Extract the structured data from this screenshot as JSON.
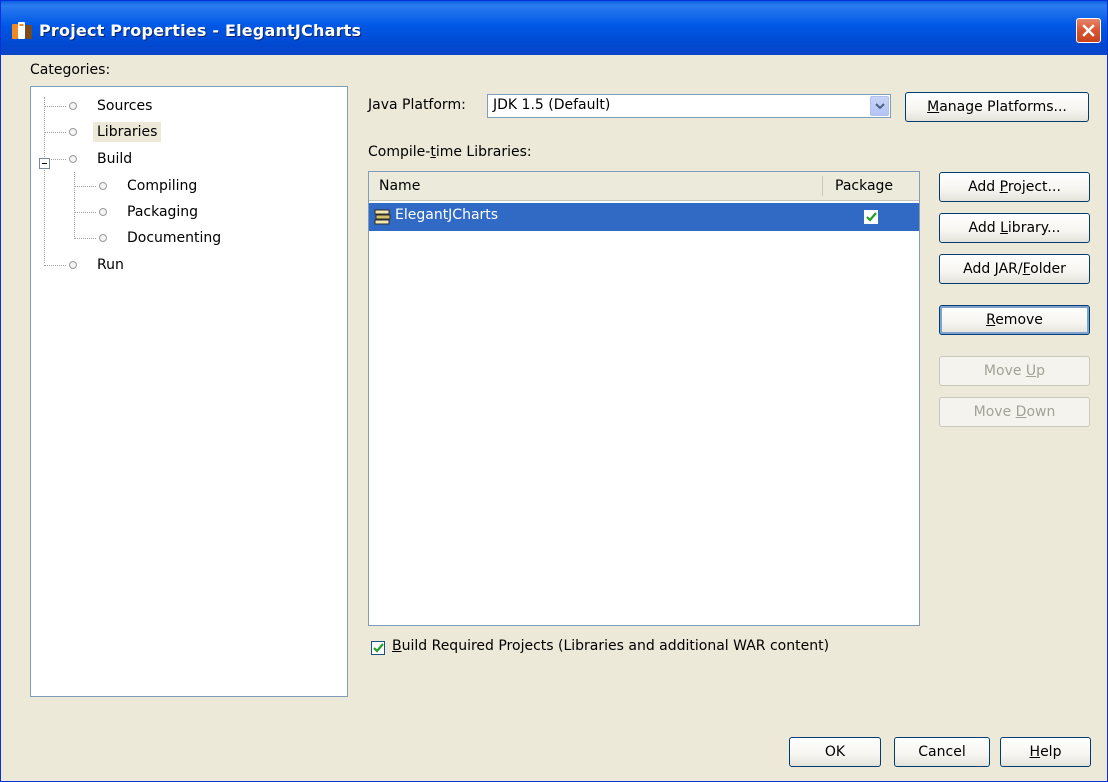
{
  "window": {
    "title": "Project Properties - ElegantJCharts",
    "close_icon": "close-icon"
  },
  "categories": {
    "label": "Categories:",
    "items": [
      {
        "label": "Sources",
        "selected": false
      },
      {
        "label": "Libraries",
        "selected": true
      },
      {
        "label": "Build",
        "selected": false,
        "expanded": true
      },
      {
        "label": "Compiling",
        "selected": false
      },
      {
        "label": "Packaging",
        "selected": false
      },
      {
        "label": "Documenting",
        "selected": false
      },
      {
        "label": "Run",
        "selected": false
      }
    ]
  },
  "java_platform": {
    "label_pre": "",
    "label_mnemonic": "J",
    "label_post": "ava Platform:",
    "value": "JDK 1.5 (Default)",
    "manage_pre": "",
    "manage_mnemonic": "M",
    "manage_post": "anage Platforms..."
  },
  "libraries": {
    "label_pre": "Compile-",
    "label_mnemonic": "t",
    "label_post": "ime Libraries:",
    "columns": [
      "Name",
      "Package"
    ],
    "rows": [
      {
        "name": "ElegantJCharts",
        "package": true,
        "icon": "library-icon"
      }
    ]
  },
  "side_buttons": {
    "add_project": {
      "pre": "Add ",
      "mnemonic": "P",
      "post": "roject..."
    },
    "add_library": {
      "pre": "Add ",
      "mnemonic": "L",
      "post": "ibrary..."
    },
    "add_jar": {
      "pre": "Add JAR/",
      "mnemonic": "F",
      "post": "older"
    },
    "remove": {
      "pre": "",
      "mnemonic": "R",
      "post": "emove"
    },
    "move_up": {
      "pre": "Move ",
      "mnemonic": "U",
      "post": "p"
    },
    "move_down": {
      "pre": "Move ",
      "mnemonic": "D",
      "post": "own"
    }
  },
  "build_required": {
    "checked": true,
    "pre": "",
    "mnemonic": "B",
    "post": "uild Required Projects (Libraries and additional WAR content)"
  },
  "footer": {
    "ok": "OK",
    "cancel": "Cancel",
    "help_pre": "",
    "help_mnemonic": "H",
    "help_post": "elp"
  },
  "colors": {
    "titlebar": "#0054e3",
    "selection": "#316ac5",
    "dialog_bg": "#ece9d8",
    "check": "#21a121"
  }
}
